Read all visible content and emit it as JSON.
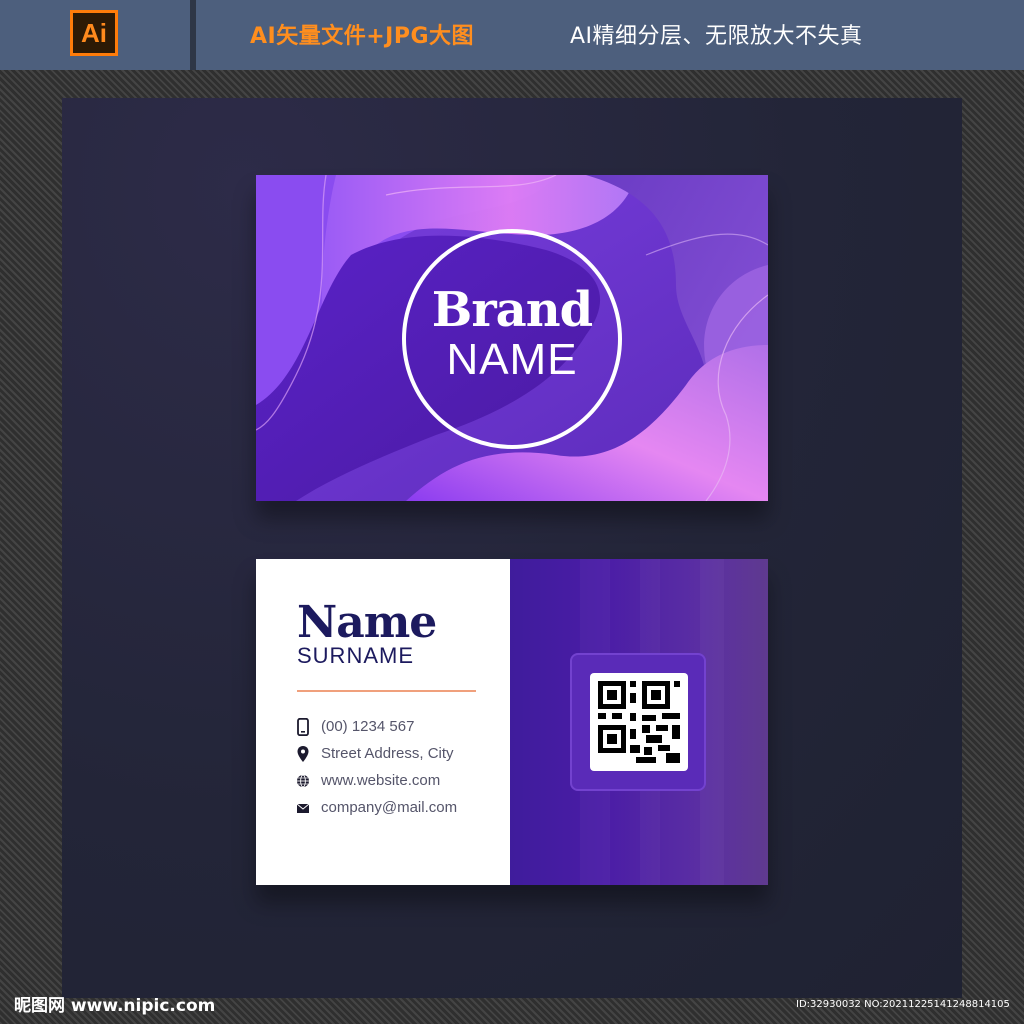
{
  "header": {
    "app_badge": "Ai",
    "promo_text": "AI矢量文件+JPG大图",
    "feature_text": "AI精细分层、无限放大不失真"
  },
  "front_card": {
    "brand_title": "Brand",
    "brand_subtitle": "NAME"
  },
  "back_card": {
    "name": "Name",
    "surname": "SURNAME",
    "contacts": [
      {
        "icon": "phone-icon",
        "text": "(00) 1234 567"
      },
      {
        "icon": "location-pin-icon",
        "text": "Street Address, City"
      },
      {
        "icon": "globe-icon",
        "text": "www.website.com"
      },
      {
        "icon": "mail-icon",
        "text": "company@mail.com"
      }
    ],
    "qr_icon": "qr-code-icon"
  },
  "watermark": {
    "site": "昵图网 www.nipic.com",
    "id_text": "ID:32930032 NO:20211225141248814105"
  },
  "colors": {
    "header_bg": "#4d5f7d",
    "accent_orange": "#ff8e1e",
    "panel_bg": "#232538",
    "card_purple": "#5b2fa3",
    "name_navy": "#1c1a5e",
    "rule_peach": "#f0a07c"
  }
}
